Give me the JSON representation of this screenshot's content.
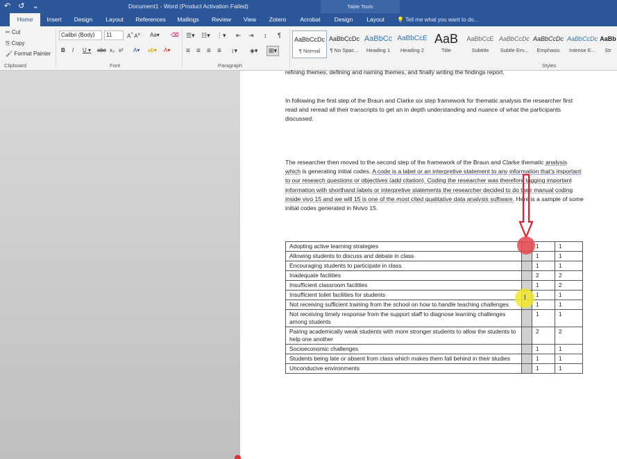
{
  "window": {
    "title": "Document1 - Word (Product Activation Failed)",
    "contextual_tab": "Table Tools"
  },
  "qat": {
    "undo": "↶",
    "redo": "↺",
    "more": "⌄"
  },
  "tabs": [
    "Home",
    "Insert",
    "Design",
    "Layout",
    "References",
    "Mailings",
    "Review",
    "View",
    "Zotero",
    "Acrobat",
    "Design",
    "Layout"
  ],
  "tell_me": "Tell me what you want to do...",
  "clipboard": {
    "cut": "Cut",
    "copy": "Copy",
    "format_painter": "Format Painter",
    "label": "Clipboard"
  },
  "font": {
    "name": "Calibri (Body)",
    "size": "11",
    "label": "Font"
  },
  "paragraph": {
    "label": "Paragraph"
  },
  "styles": {
    "label": "Styles",
    "items": [
      {
        "sample": "AaBbCcDc",
        "name": "¶ Normal"
      },
      {
        "sample": "AaBbCcDc",
        "name": "¶ No Spac..."
      },
      {
        "sample": "AaBbCc",
        "name": "Heading 1"
      },
      {
        "sample": "AaBbCcE",
        "name": "Heading 2"
      },
      {
        "sample": "AaB",
        "name": "Title"
      },
      {
        "sample": "AaBbCcE",
        "name": "Subtitle"
      },
      {
        "sample": "AaBbCcDc",
        "name": "Subtle Em..."
      },
      {
        "sample": "AaBbCcDc",
        "name": "Emphasis"
      },
      {
        "sample": "AaBbCcDc",
        "name": "Intense E..."
      },
      {
        "sample": "AaBb",
        "name": "Str"
      }
    ]
  },
  "document": {
    "p0": "refining themes, defining and naming themes, and finally writing the findings report.",
    "p1": "In following the first step of the Braun and Clarke six step framework for thematic analysis the researcher first read and reread all their transcripts to get an in depth understanding and nuance of what the participants discussed.",
    "p2a": "The researcher then moved to the second step of the framework of the Braun and Clarke thematic ",
    "p2b": "analysis which",
    "p2c": " is generating initial codes. ",
    "p2d": "A code is a label or an interpretive statement to any information that's important to our research questions or objectives (add citation). Coding the researcher was therefore tagging important information with shorthand labels or interpretive statements the researcher decided to do their manual coding inside vivo 15 and we will 15 is one of the most cited qualitative data analysis software.",
    "p2e": " Here is a sample of some initial codes generated in Nvivo 15.",
    "rows": [
      {
        "code": "Adopting  active learning strategies",
        "a": "1",
        "b": "1"
      },
      {
        "code": "Allowing students to discuss and debate in class",
        "a": "1",
        "b": "1"
      },
      {
        "code": "Encouraging students to participate in class",
        "a": "1",
        "b": "1"
      },
      {
        "code": "Inadequate facilities",
        "a": "2",
        "b": "2"
      },
      {
        "code": "Insufficient classroom facilities",
        "a": "1",
        "b": "2"
      },
      {
        "code": "Insufficient toilet facilities for students",
        "a": "1",
        "b": "1"
      },
      {
        "code": "Not receiving sufficient training from the school on how to handle teaching challenges",
        "a": "1",
        "b": "1"
      },
      {
        "code": "Not receiving timely response from the support staff to diagnose learning challenges among students",
        "a": "1",
        "b": "1"
      },
      {
        "code": "Pairing academically weak students with more stronger students to allow the students to help one another",
        "a": "2",
        "b": "2"
      },
      {
        "code": "Socioeconomic challenges",
        "a": "1",
        "b": "1"
      },
      {
        "code": "Students being late or absent from class which makes them fall behind in their studies",
        "a": "1",
        "b": "1"
      },
      {
        "code": "Unconducive environments",
        "a": "1",
        "b": "1"
      }
    ]
  }
}
